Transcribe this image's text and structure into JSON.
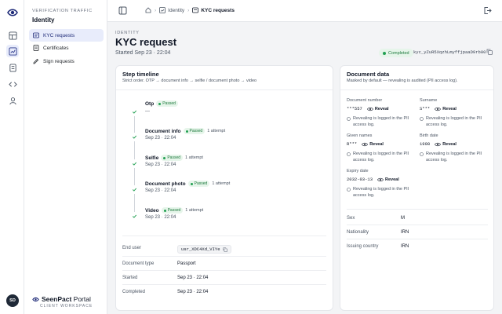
{
  "topbar": {
    "breadcrumbs": [
      "Identity",
      "KYC requests"
    ]
  },
  "sidebar": {
    "eyebrow": "VERIFICATION TRAFFIC",
    "title": "Identity",
    "items": [
      {
        "label": "KYC requests",
        "icon": "id-card-icon",
        "active": true
      },
      {
        "label": "Certificates",
        "icon": "certificate-icon",
        "active": false
      },
      {
        "label": "Sign requests",
        "icon": "signature-icon",
        "active": false
      }
    ],
    "brand": {
      "name_bold": "Seen",
      "name_mid": "Pact",
      "name_light": " Portal",
      "subtitle": "CLIENT WORKSPACE"
    },
    "avatar_initials": "SD"
  },
  "header": {
    "eyebrow": "IDENTITY",
    "title": "KYC request",
    "subtitle": "Started Sep 23 · 22:04",
    "status": "Completed",
    "request_id": "kyc_yZuR5XqzhLmyffjpaaD9rb00"
  },
  "timeline": {
    "title": "Step timeline",
    "subtitle": "Strict order. OTP → document info → selfie / document photo → video",
    "steps": [
      {
        "name": "Otp",
        "status": "Passed",
        "attempts": "",
        "time": "—"
      },
      {
        "name": "Document info",
        "status": "Passed",
        "attempts": "1 attempt",
        "time": "Sep 23 · 22:04"
      },
      {
        "name": "Selfie",
        "status": "Passed",
        "attempts": "1 attempt",
        "time": "Sep 23 · 22:04"
      },
      {
        "name": "Document photo",
        "status": "Passed",
        "attempts": "1 attempt",
        "time": "Sep 23 · 22:04"
      },
      {
        "name": "Video",
        "status": "Passed",
        "attempts": "1 attempt",
        "time": "Sep 23 · 22:04"
      }
    ],
    "details": [
      {
        "label": "End user",
        "value": "usr_XDC4Xd_VIYe"
      },
      {
        "label": "Document type",
        "value": "Passport"
      },
      {
        "label": "Started",
        "value": "Sep 23 · 22:04"
      },
      {
        "label": "Completed",
        "value": "Sep 23 · 22:04"
      }
    ]
  },
  "document": {
    "title": "Document data",
    "subtitle": "Masked by default — revealing is audited (PII access log).",
    "reveal_label": "Reveal",
    "audit_note": "Revealing is logged in the PII access log.",
    "fields": {
      "document_number": {
        "label": "Document number",
        "value": "***557"
      },
      "surname": {
        "label": "Surname",
        "value": "S***"
      },
      "given_names": {
        "label": "Given names",
        "value": "R***"
      },
      "birth_date": {
        "label": "Birth date",
        "value": "1998"
      },
      "expiry_date": {
        "label": "Expiry date",
        "value": "2032-03-13"
      }
    },
    "plain_fields": [
      {
        "label": "Sex",
        "value": "M"
      },
      {
        "label": "Nationality",
        "value": "IRN"
      },
      {
        "label": "Issuing country",
        "value": "IRN"
      }
    ]
  },
  "colors": {
    "accent": "#2d3a8c",
    "success": "#22a052",
    "active_bg": "#e8ecfb"
  }
}
